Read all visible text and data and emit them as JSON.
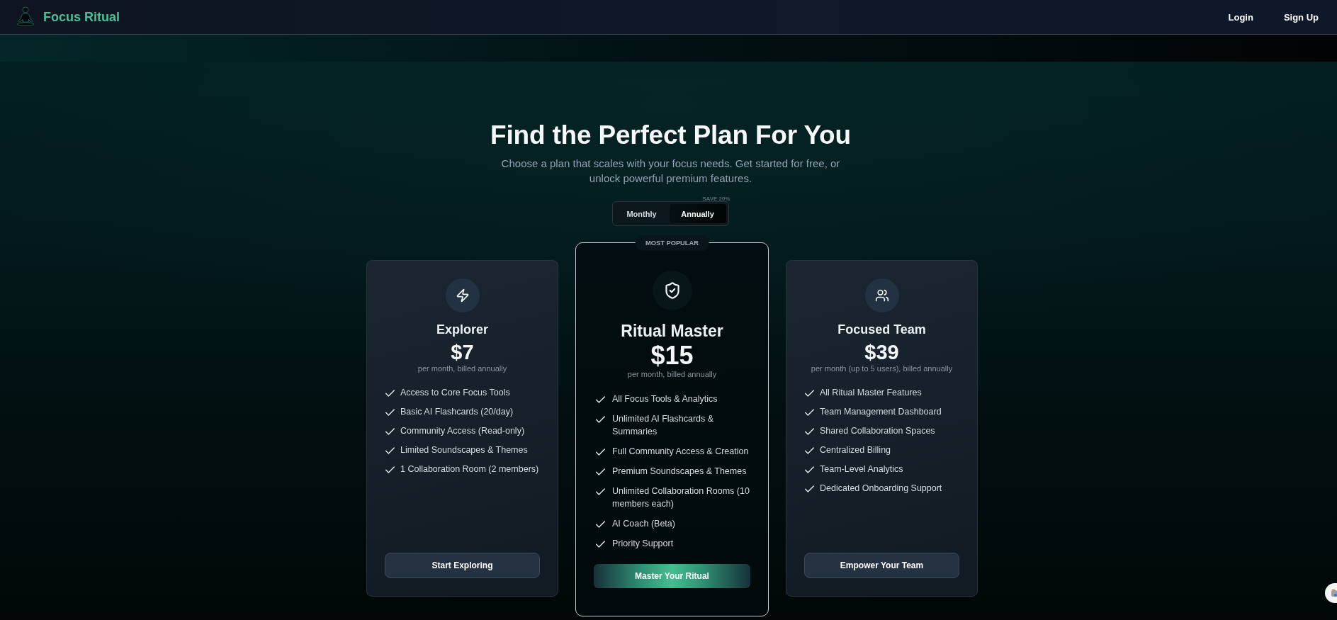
{
  "header": {
    "brand": "Focus Ritual",
    "nav": [
      {
        "label": "Login"
      },
      {
        "label": "Sign Up"
      }
    ]
  },
  "hero": {
    "title": "Find the Perfect Plan For You",
    "subtitle": "Choose a plan that scales with your focus needs. Get started for free, or unlock powerful premium features."
  },
  "billing_toggle": {
    "options": [
      {
        "label": "Monthly",
        "selected": false
      },
      {
        "label": "Annually",
        "selected": true,
        "badge": "SAVE 20%"
      }
    ]
  },
  "plans": [
    {
      "name": "Explorer",
      "featured": false,
      "price": "$7",
      "period": "per month, billed annually",
      "features": [
        "Access to Core Focus Tools",
        "Basic AI Flashcards (20/day)",
        "Community Access (Read-only)",
        "Limited Soundscapes & Themes",
        "1 Collaboration Room (2 members)"
      ],
      "cta": "Start Exploring"
    },
    {
      "name": "Ritual Master",
      "featured": true,
      "badge": "MOST POPULAR",
      "price": "$15",
      "period": "per month, billed annually",
      "features": [
        "All Focus Tools & Analytics",
        "Unlimited AI Flashcards & Summaries",
        "Full Community Access & Creation",
        "Premium Soundscapes & Themes",
        "Unlimited Collaboration Rooms (10 members each)",
        "AI Coach (Beta)",
        "Priority Support"
      ],
      "cta": "Master Your Ritual"
    },
    {
      "name": "Focused Team",
      "featured": false,
      "price": "$39",
      "period": "per month (up to 5 users), billed annually",
      "features": [
        "All Ritual Master Features",
        "Team Management Dashboard",
        "Shared Collaboration Spaces",
        "Centralized Billing",
        "Team-Level Analytics",
        "Dedicated Onboarding Support"
      ],
      "cta": "Empower Your Team"
    }
  ]
}
